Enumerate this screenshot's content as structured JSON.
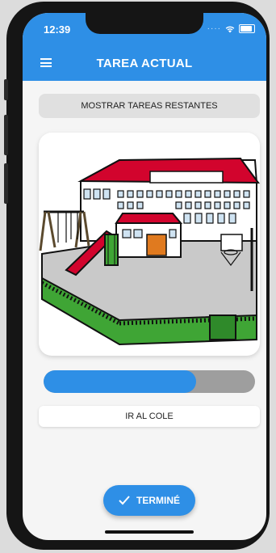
{
  "status_bar": {
    "time": "12:39"
  },
  "app_bar": {
    "title": "TAREA ACTUAL",
    "menu_icon": "hamburger-menu-icon"
  },
  "remaining_button": {
    "label": "MOSTRAR TAREAS RESTANTES"
  },
  "pictogram": {
    "icon": "school-building-pictogram"
  },
  "progress": {
    "value": 0.72
  },
  "task": {
    "name": "IR AL COLE"
  },
  "done_button": {
    "label": "TERMINÉ",
    "icon": "check-icon"
  },
  "colors": {
    "accent": "#2e8fe6",
    "track": "#9e9e9e"
  }
}
